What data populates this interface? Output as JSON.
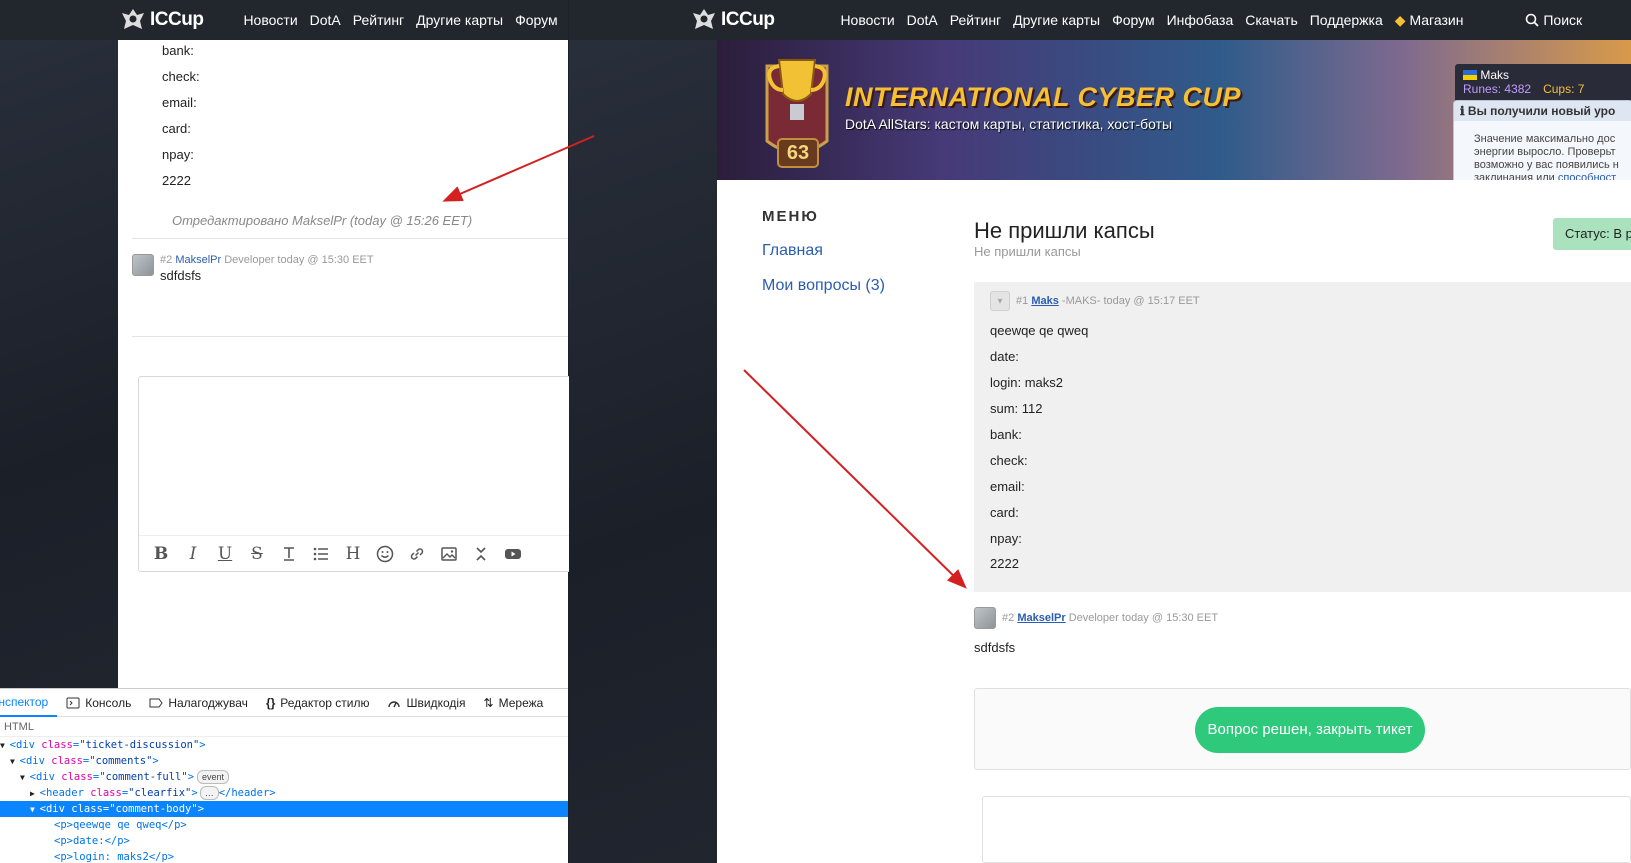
{
  "brand": "ICCup",
  "left_nav": [
    "Новости",
    "DotA",
    "Рейтинг",
    "Другие карты",
    "Форум"
  ],
  "right_nav": [
    "Новости",
    "DotA",
    "Рейтинг",
    "Другие карты",
    "Форум",
    "Инфобаза",
    "Скачать",
    "Поддержка",
    "Магазин"
  ],
  "search_label": "Поиск",
  "left_comment_lines": [
    "bank:",
    "check:",
    "email:",
    "card:",
    "npay:",
    "2222"
  ],
  "edited_note": "Отредактировано MakselPr (today @ 15:26 EET)",
  "comment2": {
    "num": "#2",
    "user": "MakselPr",
    "role": "Developer",
    "time": "today @ 15:30 EET",
    "text": "sdfdsfs"
  },
  "devtools": {
    "tabs": [
      "Інспектор",
      "Консоль",
      "Налагоджувач",
      "Редактор стилю",
      "Швидкодія",
      "Мережа"
    ],
    "sub": "HTML",
    "lines": [
      {
        "tag": "div",
        "cls": "ticket-discussion"
      },
      {
        "tag": "div",
        "cls": "comments"
      },
      {
        "tag": "div",
        "cls": "comment-full",
        "badge": "event"
      },
      {
        "tag": "header",
        "cls": "clearfix",
        "closing": "</header>"
      },
      {
        "tag": "div",
        "cls": "comment-body"
      },
      {
        "raw": "<p>qeewqe qe qweq</p>"
      },
      {
        "raw": "<p>date:</p>"
      },
      {
        "raw": "<p>login: maks2</p>"
      }
    ]
  },
  "banner": {
    "title": "INTERNATIONAL CYBER CUP",
    "subtitle": "DotA AllStars: кастом карты, статистика, хост-боты",
    "level": "63"
  },
  "user": {
    "name": "Maks",
    "runes_label": "Runes: 4382",
    "cups_label": "Cups: 7"
  },
  "notification": {
    "title": "Вы получили новый уро",
    "body": [
      "Значение максимально дос",
      "энергии выросло. Проверьт",
      "возможно у вас появились н",
      "заклинания или "
    ],
    "link": "способност"
  },
  "menu": {
    "heading": "МЕНЮ",
    "items": [
      "Главная",
      "Мои вопросы (3)"
    ]
  },
  "ticket": {
    "title": "Не пришли капсы",
    "subtitle": "Не пришли капсы",
    "status": "Статус: В разр"
  },
  "comment1": {
    "num": "#1",
    "user": "Maks",
    "clan": "-MAKS-",
    "time": "today @ 15:17 EET",
    "lines": [
      "qeewqe qe qweq",
      "date:",
      "login: maks2",
      "sum: 112",
      "bank:",
      "check:",
      "email:",
      "card:",
      "npay:",
      "2222"
    ]
  },
  "close_button": "Вопрос решен, закрыть тикет",
  "colors": {
    "navbar": "#22262d",
    "link": "#2a5db0",
    "close_button": "#2ec97a",
    "status_badge": "#a9e2bc",
    "arrow": "#d42020",
    "devtools_selection": "#0a84ff"
  }
}
